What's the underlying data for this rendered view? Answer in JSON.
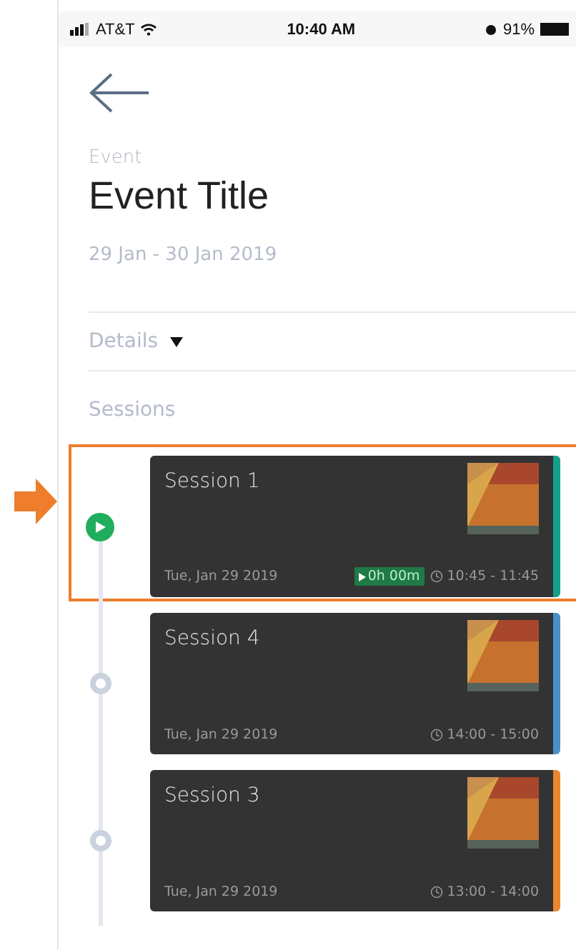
{
  "status_bar": {
    "carrier": "AT&T",
    "time": "10:40 AM",
    "battery": "91%"
  },
  "event": {
    "label": "Event",
    "title": "Event Title",
    "dates": "29 Jan - 30 Jan 2019"
  },
  "details": {
    "label": "Details",
    "expanded": false
  },
  "sessions_heading": "Sessions",
  "sessions": [
    {
      "title": "Session 1",
      "date": "Tue, Jan 29 2019",
      "time": "10:45 - 11:45",
      "kind": "live",
      "timer": "0h 00m",
      "color": "#16a08a",
      "highlighted": true
    },
    {
      "title": "Session 4",
      "date": "Tue, Jan 29 2019",
      "time": "14:00 - 15:00",
      "kind": "upcoming",
      "color": "#4a90c8",
      "highlighted": false
    },
    {
      "title": "Session 3",
      "date": "Tue, Jan 29 2019",
      "time": "13:00 - 14:00",
      "kind": "upcoming",
      "color": "#e8862e",
      "highlighted": false
    }
  ]
}
